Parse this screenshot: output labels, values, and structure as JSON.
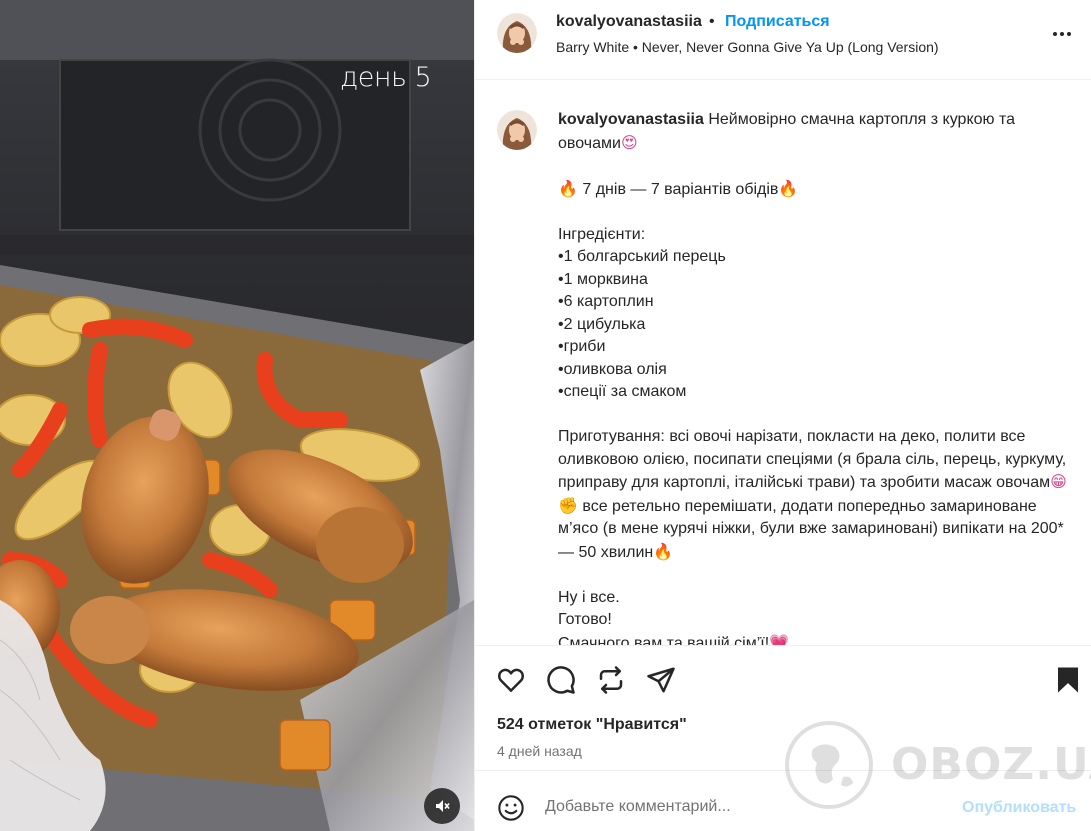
{
  "media": {
    "caption": "день 5"
  },
  "header": {
    "username": "kovalyovanastasiia",
    "separator": "•",
    "follow_label": "Подписаться",
    "music": "Barry White • Never, Never Gonna Give Ya Up (Long Version)"
  },
  "caption": {
    "username": "kovalyovanastasiia",
    "title": "Неймовірно смачна картопля з куркою та овочами",
    "title_emoji": "😍",
    "fire": "🔥",
    "series": "7 днів — 7 варіантів обідів",
    "ingredients_title": "Інгредієнти:",
    "ingredients": [
      "•1 болгарський перець",
      "•1 морквина",
      "•6 картоплин",
      "•2 цибулька",
      "•гриби",
      "•оливкова олія",
      "•спеції за смаком"
    ],
    "prep_part1": "Приготування: всі овочі нарізати, покласти на деко, полити все оливковою олією, посипати спеціями (я брала сіль, перець, куркуму, приправу для картоплі, італійські трави) та зробити масаж овочам",
    "prep_emoji1": "😁",
    "prep_emoji2": "✊",
    "prep_part2": "все ретельно перемішати, додати попередньо замариноване м’ясо (в мене курячі ніжки, були вже замариновані) випікати на 200* — 50 хвилин",
    "outro_1": "Ну і все.",
    "outro_2": "Готово!",
    "outro_3": "Смачного вам та вашій сім’ї!",
    "heart": "💗"
  },
  "actions": {
    "likes": "524 отметок \"Нравится\"",
    "time": "4 дней назад"
  },
  "comment": {
    "placeholder": "Добавьте комментарий...",
    "post_label": "Опубликовать"
  },
  "watermark": {
    "text": "OBOZ.UA"
  },
  "colors": {
    "link_blue": "#0095f6",
    "post_disabled": "#b2dffc",
    "muted": "#737373"
  },
  "icons": [
    "heart-icon",
    "comment-icon",
    "repost-icon",
    "share-icon",
    "bookmark-icon",
    "emoji-icon",
    "mute-icon",
    "more-icon"
  ]
}
